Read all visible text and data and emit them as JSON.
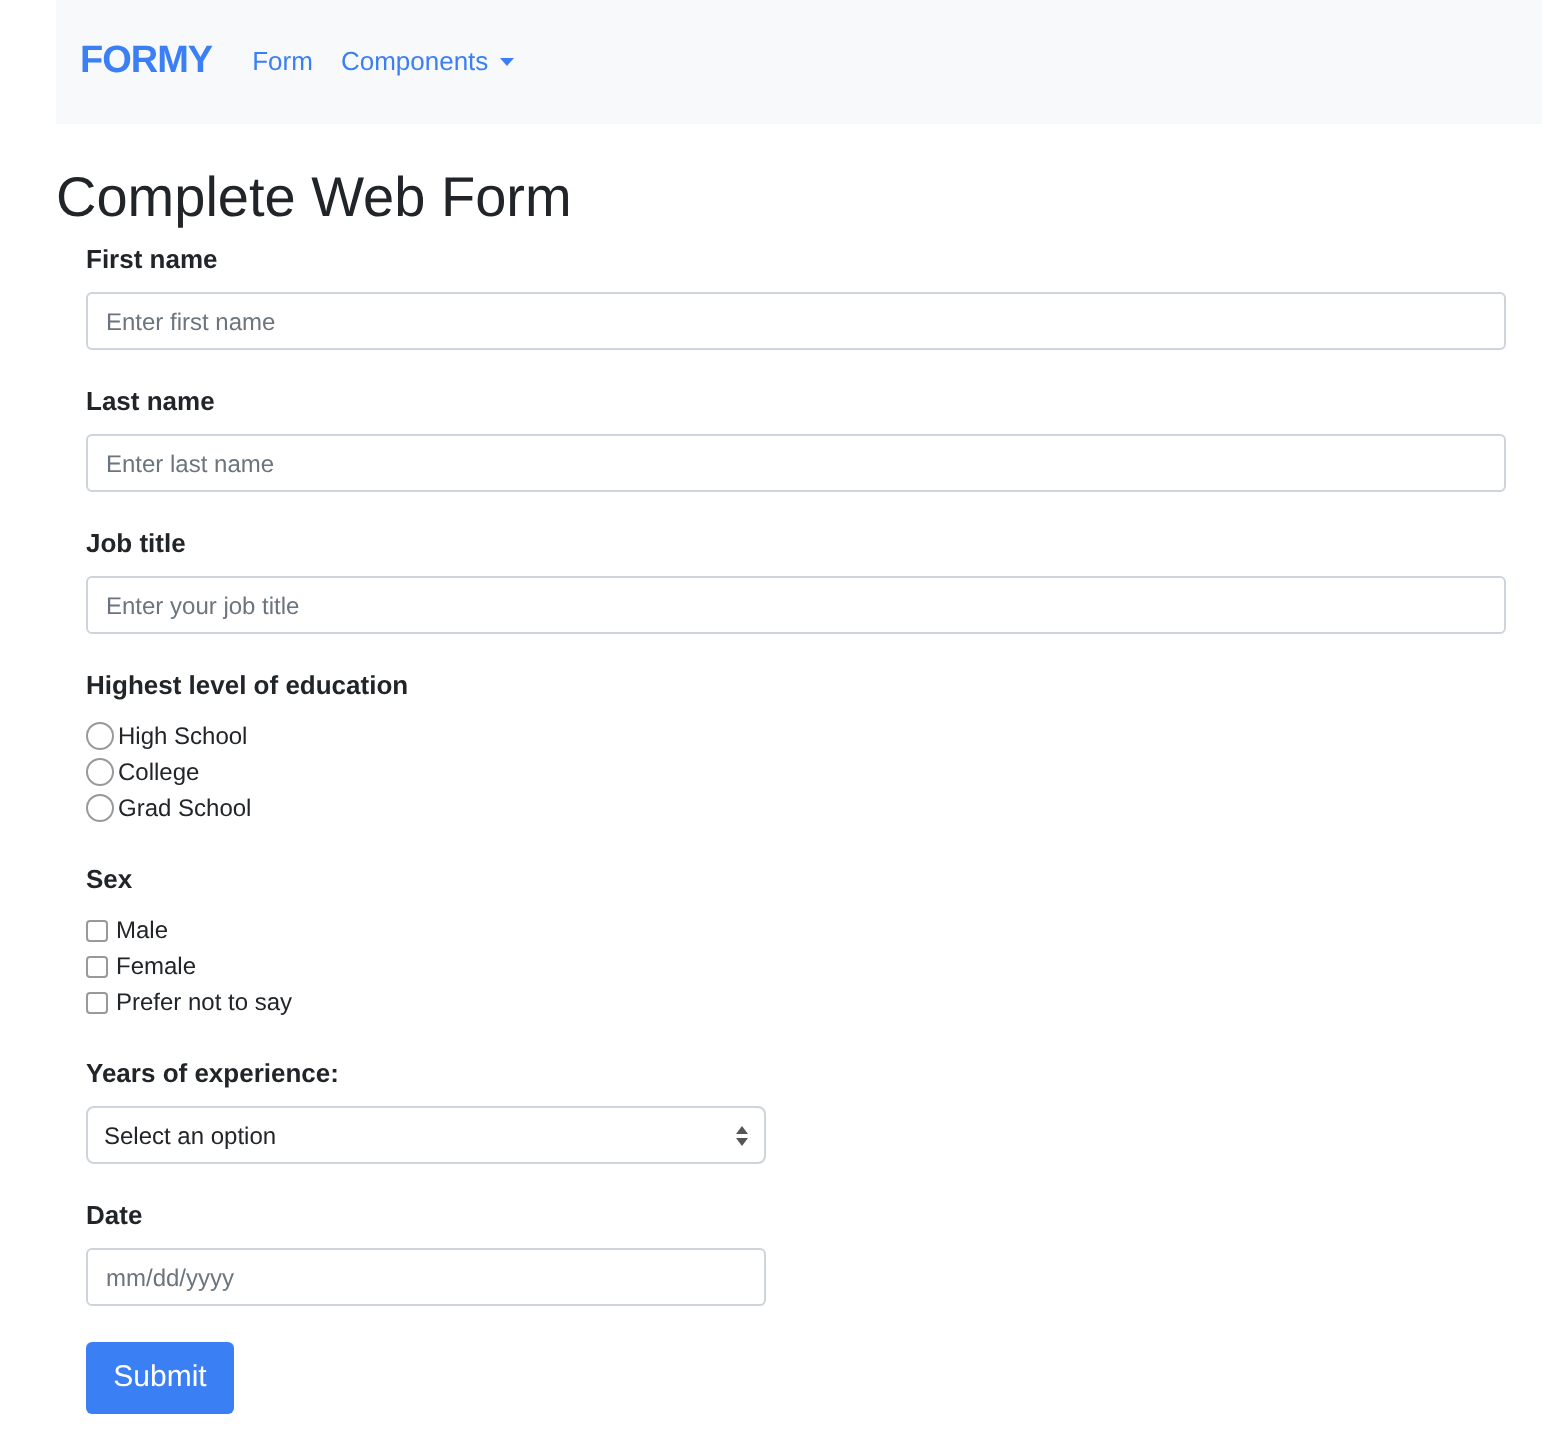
{
  "navbar": {
    "brand": "FORMY",
    "links": [
      {
        "label": "Form",
        "kind": "link"
      },
      {
        "label": "Components",
        "kind": "dropdown"
      }
    ]
  },
  "title": "Complete Web Form",
  "text_fields": [
    {
      "label": "First name",
      "placeholder": "Enter first name"
    },
    {
      "label": "Last name",
      "placeholder": "Enter last name"
    },
    {
      "label": "Job title",
      "placeholder": "Enter your job title"
    }
  ],
  "education": {
    "label": "Highest level of education",
    "options": [
      {
        "label": "High School",
        "selected": false
      },
      {
        "label": "College",
        "selected": false
      },
      {
        "label": "Grad School",
        "selected": false
      }
    ]
  },
  "sex": {
    "label": "Sex",
    "options": [
      {
        "label": "Male",
        "checked": false
      },
      {
        "label": "Female",
        "checked": false
      },
      {
        "label": "Prefer not to say",
        "checked": false
      }
    ]
  },
  "experience": {
    "label": "Years of experience:",
    "value": "Select an option"
  },
  "date": {
    "label": "Date",
    "placeholder": "mm/dd/yyyy"
  },
  "submit": "Submit"
}
